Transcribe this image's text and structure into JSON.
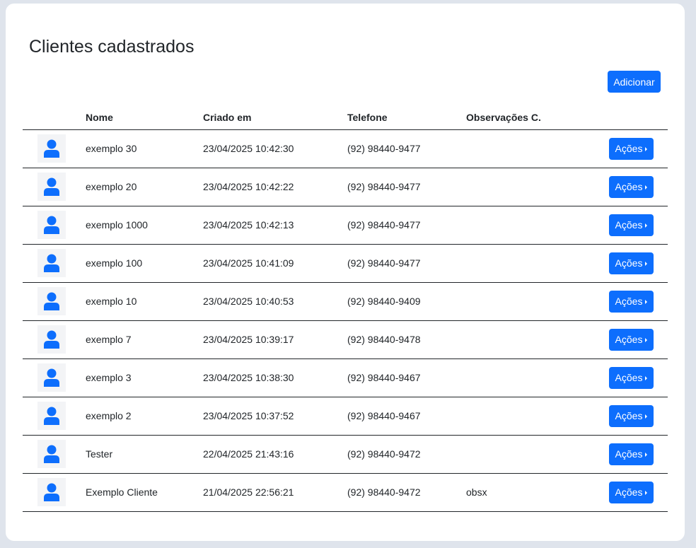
{
  "page": {
    "title": "Clientes cadastrados",
    "add_label": "Adicionar"
  },
  "table": {
    "headers": {
      "avatar": "",
      "name": "Nome",
      "created": "Criado em",
      "phone": "Telefone",
      "notes": "Observações C.",
      "actions": ""
    },
    "action_label": "Ações",
    "rows": [
      {
        "name": "exemplo 30",
        "created": "23/04/2025 10:42:30",
        "phone": "(92) 98440-9477",
        "notes": ""
      },
      {
        "name": "exemplo 20",
        "created": "23/04/2025 10:42:22",
        "phone": "(92) 98440-9477",
        "notes": ""
      },
      {
        "name": "exemplo 1000",
        "created": "23/04/2025 10:42:13",
        "phone": "(92) 98440-9477",
        "notes": ""
      },
      {
        "name": "exemplo 100",
        "created": "23/04/2025 10:41:09",
        "phone": "(92) 98440-9477",
        "notes": ""
      },
      {
        "name": "exemplo 10",
        "created": "23/04/2025 10:40:53",
        "phone": "(92) 98440-9409",
        "notes": ""
      },
      {
        "name": "exemplo 7",
        "created": "23/04/2025 10:39:17",
        "phone": "(92) 98440-9478",
        "notes": ""
      },
      {
        "name": "exemplo 3",
        "created": "23/04/2025 10:38:30",
        "phone": "(92) 98440-9467",
        "notes": ""
      },
      {
        "name": "exemplo 2",
        "created": "23/04/2025 10:37:52",
        "phone": "(92) 98440-9467",
        "notes": ""
      },
      {
        "name": "Tester",
        "created": "22/04/2025 21:43:16",
        "phone": "(92) 98440-9472",
        "notes": ""
      },
      {
        "name": "Exemplo Cliente",
        "created": "21/04/2025 22:56:21",
        "phone": "(92) 98440-9472",
        "notes": "obsx"
      }
    ]
  },
  "icons": {
    "avatar": "user-icon",
    "caret": "caret-right-icon"
  },
  "colors": {
    "primary": "#0d6efd",
    "avatar_bg": "#f3f4f6",
    "page_bg": "#dfe4ec"
  }
}
